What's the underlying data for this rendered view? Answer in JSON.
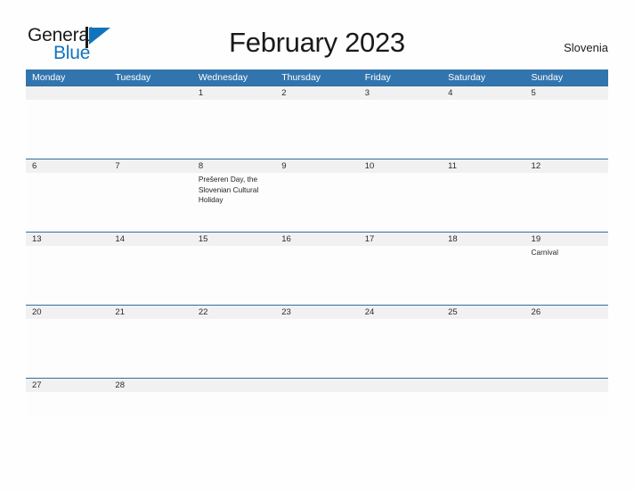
{
  "brand": {
    "name_part1": "General",
    "name_part2": "Blue",
    "flag_icon": "flag-triangle-icon",
    "color_dark": "#1b1b1b",
    "color_blue": "#1273bd"
  },
  "header": {
    "title": "February 2023",
    "country": "Slovenia"
  },
  "theme": {
    "header_blue": "#3275ae",
    "row_divider_blue": "#2e6da4",
    "number_band_gray": "#f1f1f1",
    "text_dark": "#1f1f1f"
  },
  "weekdays": [
    "Monday",
    "Tuesday",
    "Wednesday",
    "Thursday",
    "Friday",
    "Saturday",
    "Sunday"
  ],
  "weeks": [
    {
      "days": [
        {
          "number": "",
          "event": ""
        },
        {
          "number": "",
          "event": ""
        },
        {
          "number": "1",
          "event": ""
        },
        {
          "number": "2",
          "event": ""
        },
        {
          "number": "3",
          "event": ""
        },
        {
          "number": "4",
          "event": ""
        },
        {
          "number": "5",
          "event": ""
        }
      ]
    },
    {
      "days": [
        {
          "number": "6",
          "event": ""
        },
        {
          "number": "7",
          "event": ""
        },
        {
          "number": "8",
          "event": "Prešeren Day, the Slovenian Cultural Holiday"
        },
        {
          "number": "9",
          "event": ""
        },
        {
          "number": "10",
          "event": ""
        },
        {
          "number": "11",
          "event": ""
        },
        {
          "number": "12",
          "event": ""
        }
      ]
    },
    {
      "days": [
        {
          "number": "13",
          "event": ""
        },
        {
          "number": "14",
          "event": ""
        },
        {
          "number": "15",
          "event": ""
        },
        {
          "number": "16",
          "event": ""
        },
        {
          "number": "17",
          "event": ""
        },
        {
          "number": "18",
          "event": ""
        },
        {
          "number": "19",
          "event": "Carnival"
        }
      ]
    },
    {
      "days": [
        {
          "number": "20",
          "event": ""
        },
        {
          "number": "21",
          "event": ""
        },
        {
          "number": "22",
          "event": ""
        },
        {
          "number": "23",
          "event": ""
        },
        {
          "number": "24",
          "event": ""
        },
        {
          "number": "25",
          "event": ""
        },
        {
          "number": "26",
          "event": ""
        }
      ]
    },
    {
      "days": [
        {
          "number": "27",
          "event": ""
        },
        {
          "number": "28",
          "event": ""
        },
        {
          "number": "",
          "event": ""
        },
        {
          "number": "",
          "event": ""
        },
        {
          "number": "",
          "event": ""
        },
        {
          "number": "",
          "event": ""
        },
        {
          "number": "",
          "event": ""
        }
      ]
    }
  ]
}
